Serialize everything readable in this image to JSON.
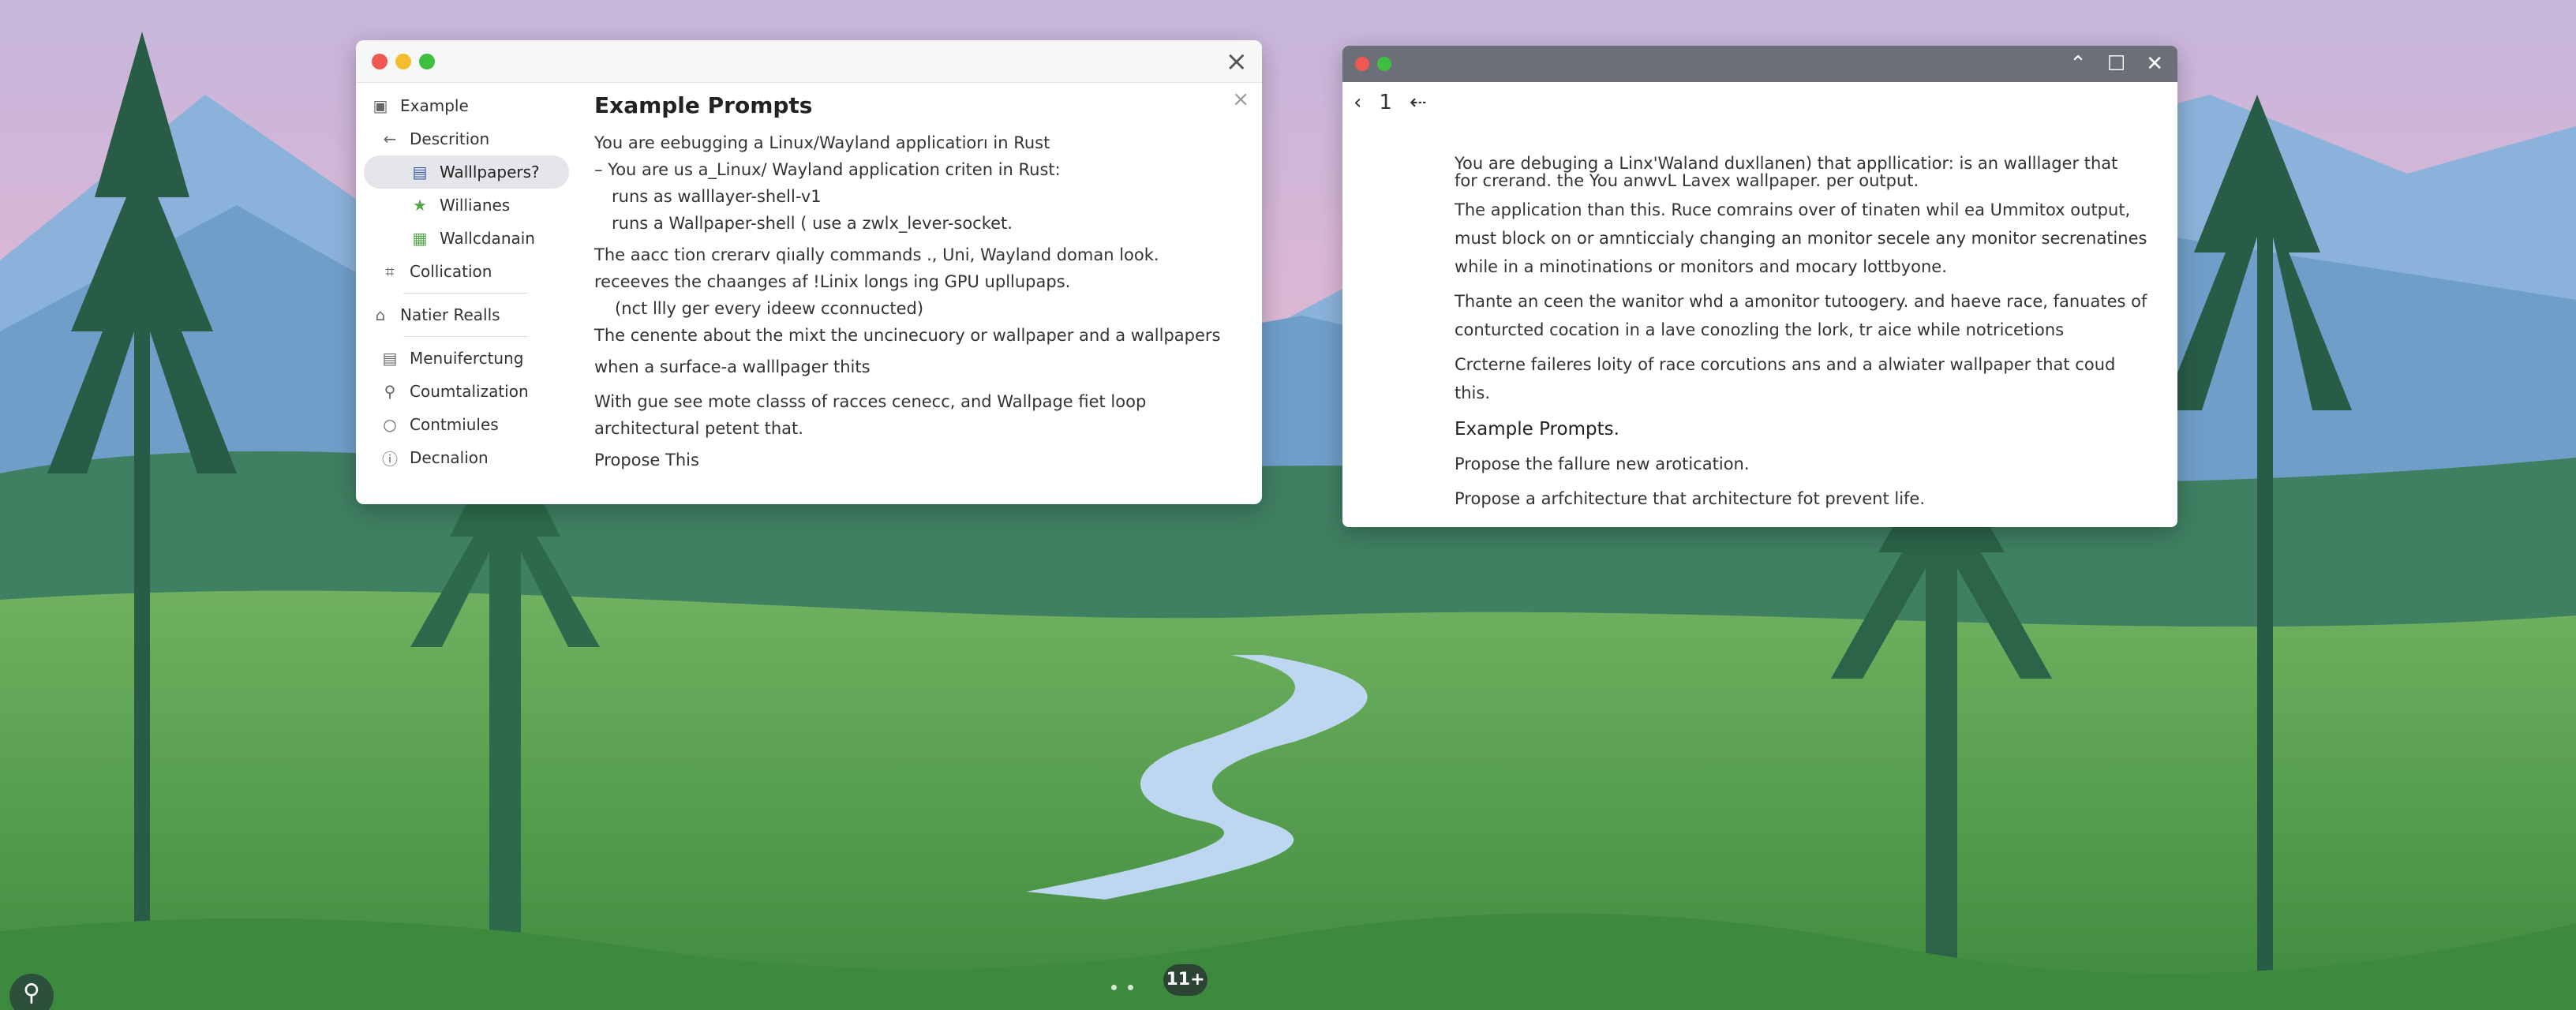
{
  "window1": {
    "sidebar": {
      "items": [
        {
          "label": "Example",
          "icon": "clipboard-icon"
        },
        {
          "label": "Descrition",
          "icon": "back-arrow-icon"
        },
        {
          "label": "Walllpapers?",
          "icon": "monitor-icon"
        },
        {
          "label": "Willianes",
          "icon": "star-icon"
        },
        {
          "label": "Wallcdanain",
          "icon": "image-icon"
        },
        {
          "label": "Collication",
          "icon": "collection-icon"
        },
        {
          "label": "Natier Realls",
          "icon": "house-icon"
        },
        {
          "label": "Menuiferctung",
          "icon": "menu-icon"
        },
        {
          "label": "Coumtalization",
          "icon": "wrench-icon"
        },
        {
          "label": "Contmiules",
          "icon": "circle-icon"
        },
        {
          "label": "Decnalion",
          "icon": "info-icon"
        }
      ]
    },
    "content": {
      "heading": "Example Prompts",
      "lines": [
        "You are eebugging a Linux/Wayland applicatiorı in Rust",
        "– You are us a_Linux/ Wayland application criten in Rust:",
        "runs as walllayer-shell-v1",
        "runs a  Wallpaper-shell ( use a zwlx_lever-socket.",
        "The aacc tion crerarv qiıally commands ., Uni, Wayland doman look.",
        "receeves the chaanges af !Linix longs ing  GPU upllupaps.",
        "(nct llly ger every ideew cconnucted)",
        "The cenente about the mixt the uncinecuory or wallpaper and a wallpapers",
        "when a surface-a walllpager thits",
        "With gue see mote classs of racces cenecc, and Wallpage fiet loop",
        "architectural petent that.",
        "Propose This"
      ]
    }
  },
  "window2": {
    "nav": {
      "page": "1"
    },
    "lines": [
      "You are debuging a Linx'Waland duxllanen) that appllicatior: is an walllager that",
      "for crerand. the  You anwvL Lavex wallpaper. per output.",
      "The application than this. Ruce comrains over of tinaten whil ea Ummitox output,",
      "must block on or amnticcialy changing an monitor secele any monitor secrenatines",
      "while in a minotinations or monitors and mocary lottbyone.",
      "Thante an ceen the wanitor whd a amonitor tutoogery. and haeve race, fanuates of",
      "conturcted cocation in a lave conozling the lork, tr aice while notricetions",
      "Crcterne faileres loity of race corcutions ans and a alwiater wallpaper that coud",
      "this."
    ],
    "subheading": "Example Prompts.",
    "closing": [
      "Propose the fallure new arotication.",
      "Propose a arfchitecture that architecture fot prevent life."
    ]
  },
  "dock": {
    "badge": "11+",
    "search_icon": "search-icon"
  },
  "colors": {
    "sky_top": "#c9b8dd",
    "sky_bottom": "#f0b8c6",
    "grass": "#5aa54e",
    "forest": "#2f6e4f",
    "river": "#b9d6ee"
  }
}
